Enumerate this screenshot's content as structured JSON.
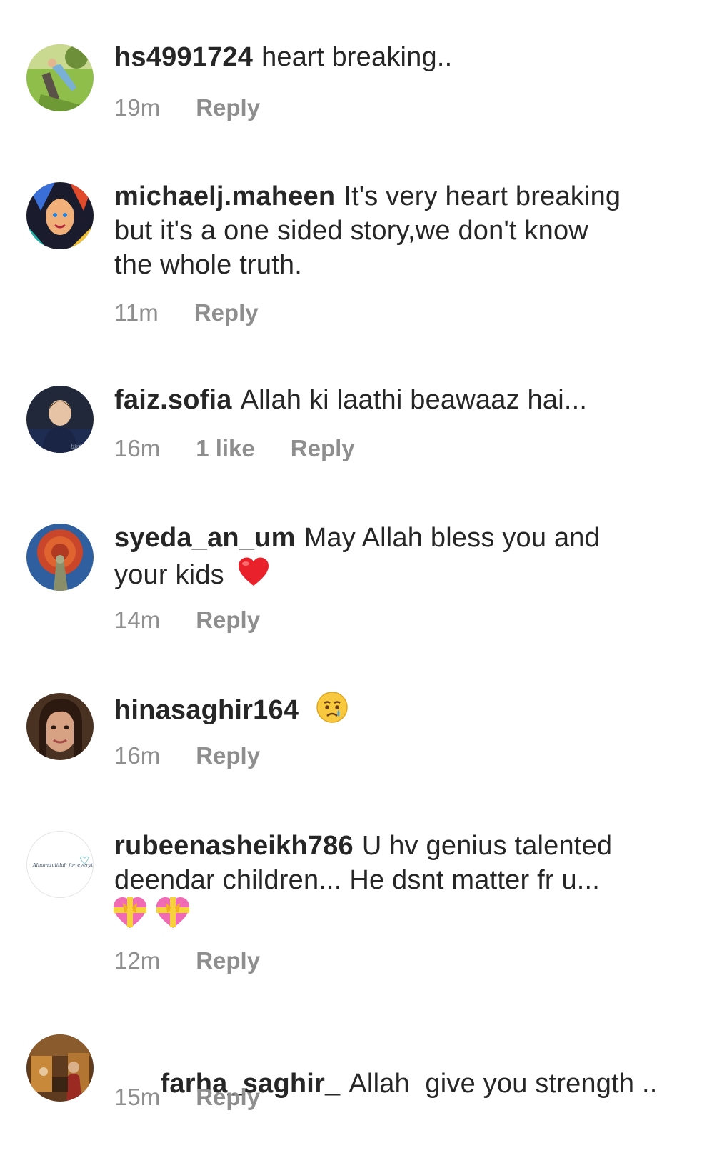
{
  "comments": [
    {
      "username": "hs4991724",
      "text": "heart breaking..",
      "time": "19m",
      "likes": "",
      "reply": "Reply"
    },
    {
      "username": "michaelj.maheen",
      "text": "It's very heart breaking but it's a one sided story,we don't know the whole truth.",
      "time": "11m",
      "likes": "",
      "reply": "Reply"
    },
    {
      "username": "faiz.sofia",
      "text": "Allah ki laathi beawaaz hai...",
      "time": "16m",
      "likes": "1 like",
      "reply": "Reply"
    },
    {
      "username": "syeda_an_um",
      "text": "May Allah bless you and your kids",
      "emoji": "red-heart",
      "time": "14m",
      "likes": "",
      "reply": "Reply"
    },
    {
      "username": "hinasaghir164",
      "text": "",
      "emoji": "crying-face",
      "time": "16m",
      "likes": "",
      "reply": "Reply"
    },
    {
      "username": "rubeenasheikh786",
      "text": "U hv genius talented deendar children... He dsnt matter fr u...",
      "emoji": "heart-with-ribbon x2",
      "avatar_text": "Alhamdulillah for everything",
      "time": "12m",
      "likes": "",
      "reply": "Reply"
    },
    {
      "username": "farha_saghir_",
      "text": "Allah  give you strength ..",
      "time": "15m",
      "likes": "",
      "reply": "Reply"
    }
  ],
  "colors": {
    "text": "#262626",
    "meta": "#8e8e8e",
    "background": "#ffffff"
  }
}
